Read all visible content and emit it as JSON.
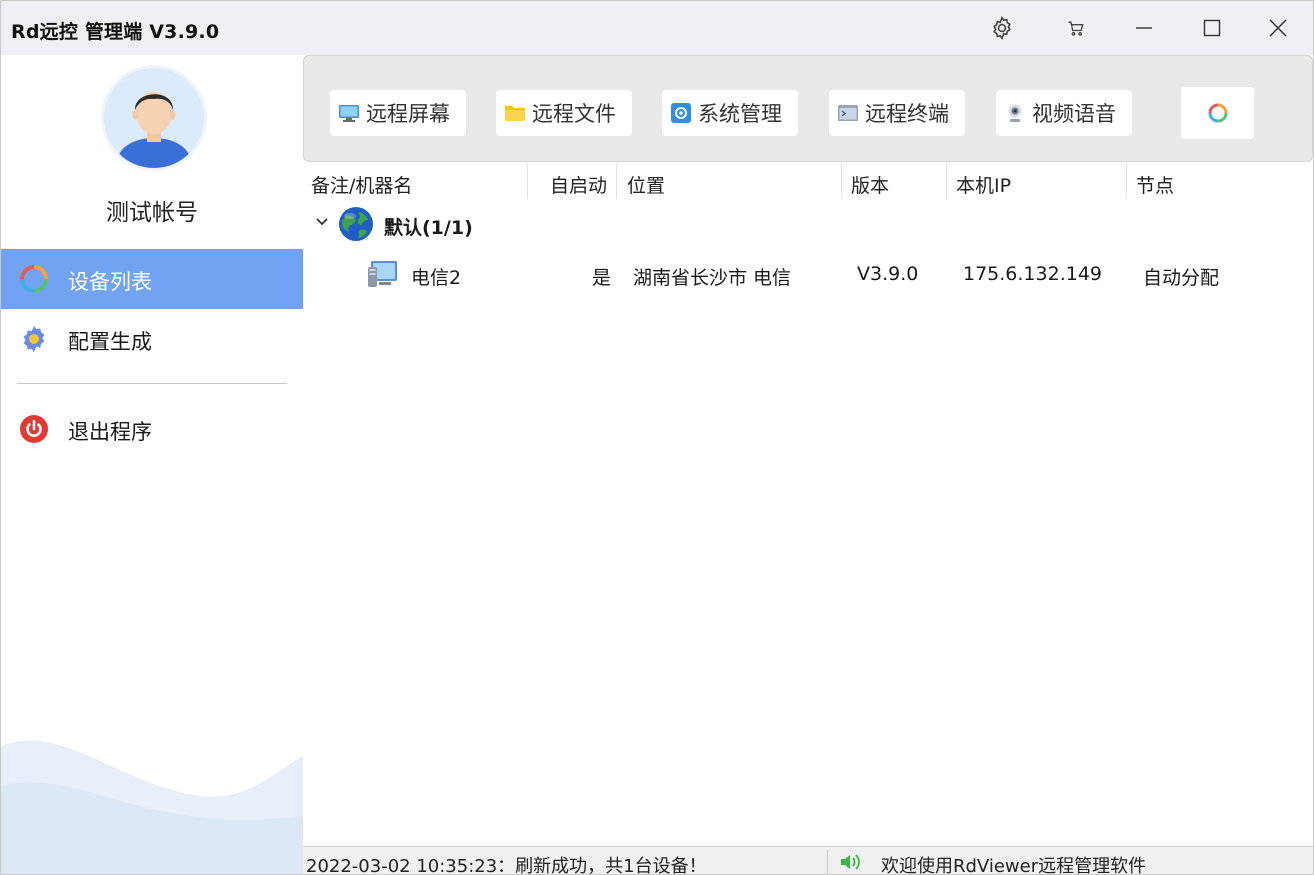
{
  "window": {
    "title": "Rd远控  管理端 V3.9.0"
  },
  "sidebar": {
    "account_name": "测试帐号",
    "items": [
      {
        "label": "设备列表",
        "icon": "refresh-ring-icon",
        "active": true
      },
      {
        "label": "配置生成",
        "icon": "gear-icon",
        "active": false
      },
      {
        "label": "退出程序",
        "icon": "power-icon",
        "active": false
      }
    ]
  },
  "toolbar": {
    "buttons": [
      {
        "label": "远程屏幕",
        "icon": "monitor-icon"
      },
      {
        "label": "远程文件",
        "icon": "folder-icon"
      },
      {
        "label": "系统管理",
        "icon": "system-settings-icon"
      },
      {
        "label": "远程终端",
        "icon": "terminal-icon"
      },
      {
        "label": "视频语音",
        "icon": "webcam-icon"
      }
    ]
  },
  "table": {
    "columns": [
      "备注/机器名",
      "自启动",
      "位置",
      "版本",
      "本机IP",
      "节点"
    ],
    "groups": [
      {
        "name": "默认(1/1)",
        "rows": [
          {
            "name": "电信2",
            "autostart": "是",
            "location": "湖南省长沙市 电信",
            "version": "V3.9.0",
            "ip": "175.6.132.149",
            "node": "自动分配"
          }
        ]
      }
    ]
  },
  "status": {
    "left": "2022-03-02 10:35:23：刷新成功，共1台设备！",
    "right": "欢迎使用RdViewer远程管理软件"
  },
  "colors": {
    "accent": "#72a3f2",
    "titlebar": "#eef0f3",
    "toolbar": "#e9e9ea"
  }
}
